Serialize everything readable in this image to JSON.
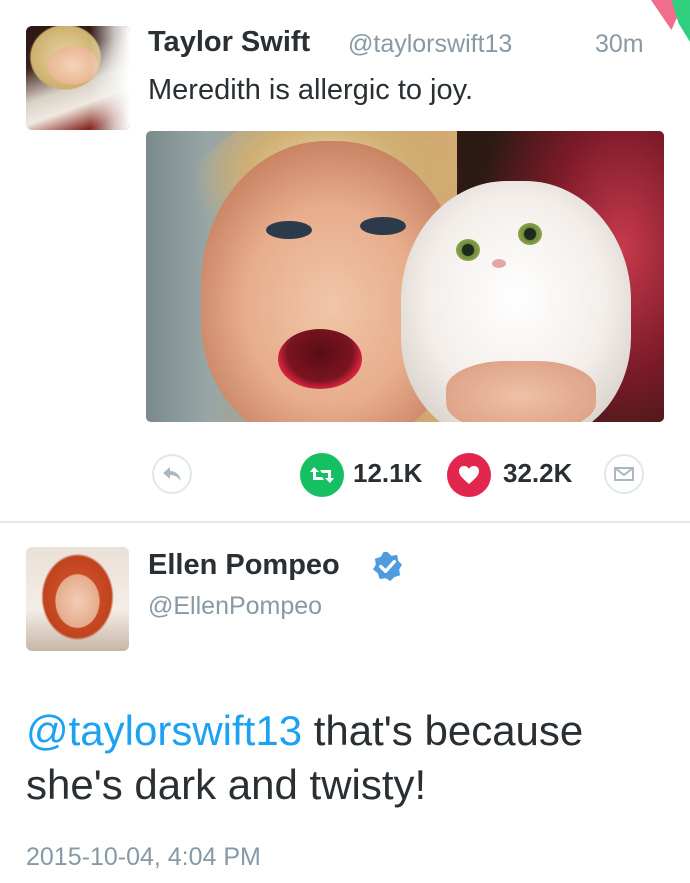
{
  "tweet1": {
    "display_name": "Taylor Swift",
    "handle": "@taylorswift13",
    "time_ago": "30m",
    "text": "Meredith is allergic to joy.",
    "retweet_count": "12.1K",
    "like_count": "32.2K",
    "icons": {
      "reply": "reply-icon",
      "retweet": "retweet-icon",
      "like": "heart-icon",
      "dm": "envelope-icon"
    }
  },
  "tweet2": {
    "display_name": "Ellen Pompeo",
    "handle": "@EllenPompeo",
    "verified": true,
    "mention": "@taylorswift13",
    "text_rest": " that's because she's dark and twisty!",
    "timestamp": "2015-10-04, 4:04 PM"
  },
  "colors": {
    "retweet_green": "#17bf63",
    "like_red": "#e2264d",
    "link_blue": "#1da1f2",
    "muted_gray": "#8899a6",
    "text": "#292f33"
  }
}
